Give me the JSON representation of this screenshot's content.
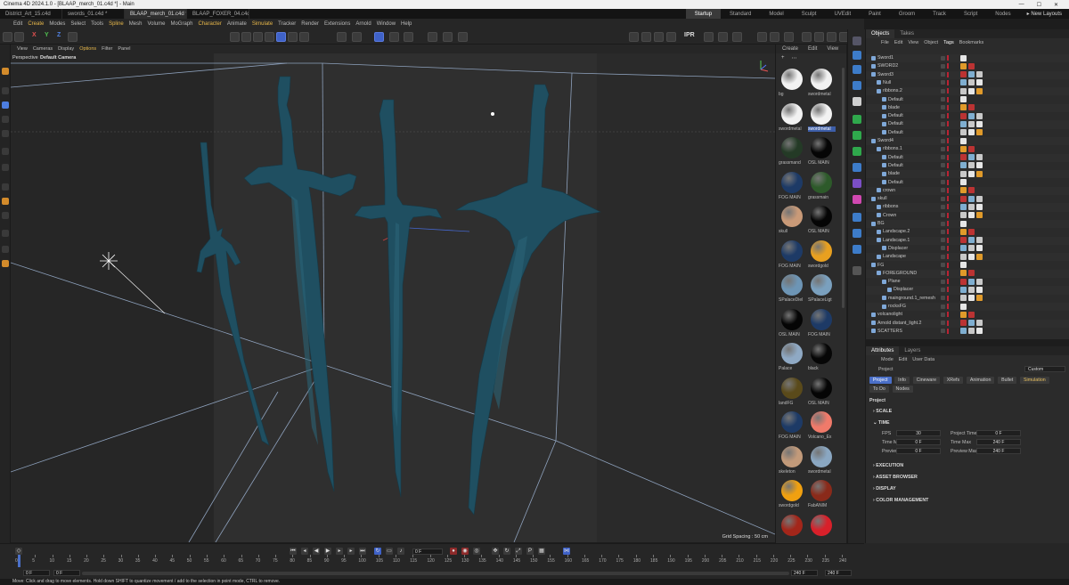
{
  "window": {
    "title": "Cinema 4D 2024.1.0 - [BLAAP_merch_01.c4d *] - Main",
    "controls": [
      "—",
      "☐",
      "✕"
    ]
  },
  "doc_tabs": [
    {
      "label": "District_Art_15.c4d",
      "active": false
    },
    {
      "label": "swords_01.c4d *",
      "active": false
    },
    {
      "label": "BLAAP_merch_01.c4d *",
      "active": true
    },
    {
      "label": "BLAAP_FOXER_04.c4d *",
      "active": false
    }
  ],
  "layouts": {
    "items": [
      "Startup",
      "Standard",
      "Model",
      "Sculpt",
      "UVEdit",
      "Paint",
      "Groom",
      "Track",
      "Script",
      "Nodes"
    ],
    "active": "Startup",
    "new_layouts": "New Layouts"
  },
  "menubar": [
    "Edit",
    "Create",
    "Modes",
    "Select",
    "Tools",
    "Spline",
    "Mesh",
    "Volume",
    "MoGraph",
    "Character",
    "Animate",
    "Simulate",
    "Tracker",
    "Render",
    "Extensions",
    "Arnold",
    "Window",
    "Help"
  ],
  "toolbar": {
    "axes": [
      "X",
      "Y",
      "Z"
    ],
    "ipr": "IPR"
  },
  "viewport": {
    "menu": [
      "View",
      "Cameras",
      "Display",
      "Options",
      "Filter",
      "Panel"
    ],
    "label": "Perspective",
    "camera": "Default Camera",
    "grid_spacing": "Grid Spacing : 50 cm"
  },
  "materials": {
    "menu": [
      "Create",
      "Edit",
      "View"
    ],
    "items": [
      {
        "name": "bg",
        "color": "#f2f2f2"
      },
      {
        "name": "swordmetal",
        "color": "#f2f2f2"
      },
      {
        "name": "swordmetal",
        "color": "#f2f2f2"
      },
      {
        "name": "swordmetal",
        "color": "#f2f2f2",
        "selected": true
      },
      {
        "name": "grassmand",
        "color": "#243a26"
      },
      {
        "name": "OSL MAIN",
        "color": "#050505"
      },
      {
        "name": "FOG MAIN",
        "color": "#1d3a66"
      },
      {
        "name": "grassmain",
        "color": "#2d5a2a"
      },
      {
        "name": "skull",
        "color": "#c99a78"
      },
      {
        "name": "OSL MAIN",
        "color": "#050505"
      },
      {
        "name": "FOG MAIN",
        "color": "#1d3a66"
      },
      {
        "name": "swordgold",
        "color": "#e8a020"
      },
      {
        "name": "SPalaceDiel",
        "color": "#6d95b5"
      },
      {
        "name": "SPalaceLigt",
        "color": "#7aa0be"
      },
      {
        "name": "OSL MAIN",
        "color": "#050505"
      },
      {
        "name": "FOG MAIN",
        "color": "#1d3a66"
      },
      {
        "name": "Palace",
        "color": "#8fa9c4"
      },
      {
        "name": "black",
        "color": "#060606"
      },
      {
        "name": "landFG",
        "color": "#5a4a1a"
      },
      {
        "name": "OSL MAIN",
        "color": "#050505"
      },
      {
        "name": "FOG MAIN",
        "color": "#1d3a66"
      },
      {
        "name": "Volcano_Ex",
        "color": "#f07a6a"
      },
      {
        "name": "skeleton",
        "color": "#c29a7a"
      },
      {
        "name": "swordmetal",
        "color": "#8aa7c2"
      },
      {
        "name": "swordgold",
        "color": "#f0a010"
      },
      {
        "name": "FabANIM",
        "color": "#8a2a1a"
      },
      {
        "name": "",
        "color": "#a3261a"
      },
      {
        "name": "",
        "color": "#d8202a"
      }
    ]
  },
  "objects": {
    "tabs": [
      "Objects",
      "Takes"
    ],
    "menu": [
      "File",
      "Edit",
      "View",
      "Object",
      "Tags",
      "Bookmarks"
    ],
    "rows": [
      {
        "name": "Sword1",
        "indent": 0
      },
      {
        "name": "SWORD2",
        "indent": 0
      },
      {
        "name": "Sword3",
        "indent": 0
      },
      {
        "name": "Null",
        "indent": 1
      },
      {
        "name": "ribbons.2",
        "indent": 1
      },
      {
        "name": "Default",
        "indent": 2
      },
      {
        "name": "blade",
        "indent": 2
      },
      {
        "name": "Default",
        "indent": 2
      },
      {
        "name": "Default",
        "indent": 2
      },
      {
        "name": "Default",
        "indent": 2
      },
      {
        "name": "Sword4",
        "indent": 0
      },
      {
        "name": "ribbons.1",
        "indent": 1
      },
      {
        "name": "Default",
        "indent": 2
      },
      {
        "name": "Default",
        "indent": 2
      },
      {
        "name": "blade",
        "indent": 2
      },
      {
        "name": "Default",
        "indent": 2
      },
      {
        "name": "crown",
        "indent": 1
      },
      {
        "name": "skull",
        "indent": 0
      },
      {
        "name": "ribbons",
        "indent": 1
      },
      {
        "name": "Crown",
        "indent": 1
      },
      {
        "name": "BG",
        "indent": 0
      },
      {
        "name": "Landscape.2",
        "indent": 1
      },
      {
        "name": "Landscape.1",
        "indent": 1
      },
      {
        "name": "Displacer",
        "indent": 2
      },
      {
        "name": "Landscape",
        "indent": 1
      },
      {
        "name": "FG",
        "indent": 0
      },
      {
        "name": "FOREGROUND",
        "indent": 1
      },
      {
        "name": "Plane",
        "indent": 2
      },
      {
        "name": "Displacer",
        "indent": 3
      },
      {
        "name": "mainground.1_remesh",
        "indent": 2
      },
      {
        "name": "rocksFG",
        "indent": 2
      },
      {
        "name": "volcanolight",
        "indent": 0
      },
      {
        "name": "Arnold distant_light.2",
        "indent": 0
      },
      {
        "name": "SCATTERS",
        "indent": 0
      }
    ]
  },
  "attributes": {
    "tabs": [
      "Attributes",
      "Layers"
    ],
    "menu": [
      "Mode",
      "Edit",
      "User Data"
    ],
    "title": "Project",
    "preset": "Custom",
    "subtabs": [
      "Project",
      "Info",
      "Cineware",
      "XRefs",
      "Animation",
      "Bullet",
      "Simulation",
      "To Do",
      "Nodes"
    ],
    "section": "Project",
    "scale": "SCALE",
    "time": "TIME",
    "fields": [
      {
        "label": "FPS",
        "value": "30"
      },
      {
        "label": "Project Time",
        "value": "0 F"
      },
      {
        "label": "Time Min",
        "value": "0 F"
      },
      {
        "label": "Time Max",
        "value": "240 F"
      },
      {
        "label": "Preview Min",
        "value": "0 F"
      },
      {
        "label": "Preview Max",
        "value": "240 F"
      }
    ],
    "sections": [
      "EXECUTION",
      "ASSET BROWSER",
      "DISPLAY",
      "COLOR MANAGEMENT"
    ]
  },
  "timeline": {
    "current": "0 F",
    "start": "0 F",
    "start2": "0 F",
    "end": "240 F",
    "end2": "240 F",
    "ticks": [
      "0",
      "5",
      "10",
      "15",
      "20",
      "25",
      "30",
      "35",
      "40",
      "45",
      "50",
      "55",
      "60",
      "65",
      "70",
      "75",
      "80",
      "85",
      "90",
      "95",
      "100",
      "105",
      "110",
      "115",
      "120",
      "125",
      "130",
      "135",
      "140",
      "145",
      "150",
      "155",
      "160",
      "165",
      "170",
      "175",
      "180",
      "185",
      "190",
      "195",
      "200",
      "205",
      "210",
      "215",
      "220",
      "225",
      "230",
      "235",
      "240"
    ]
  },
  "status": "Move: Click and drag to move elements. Hold down SHIFT to quantize movement / add to the selection in point mode, CTRL to remove."
}
